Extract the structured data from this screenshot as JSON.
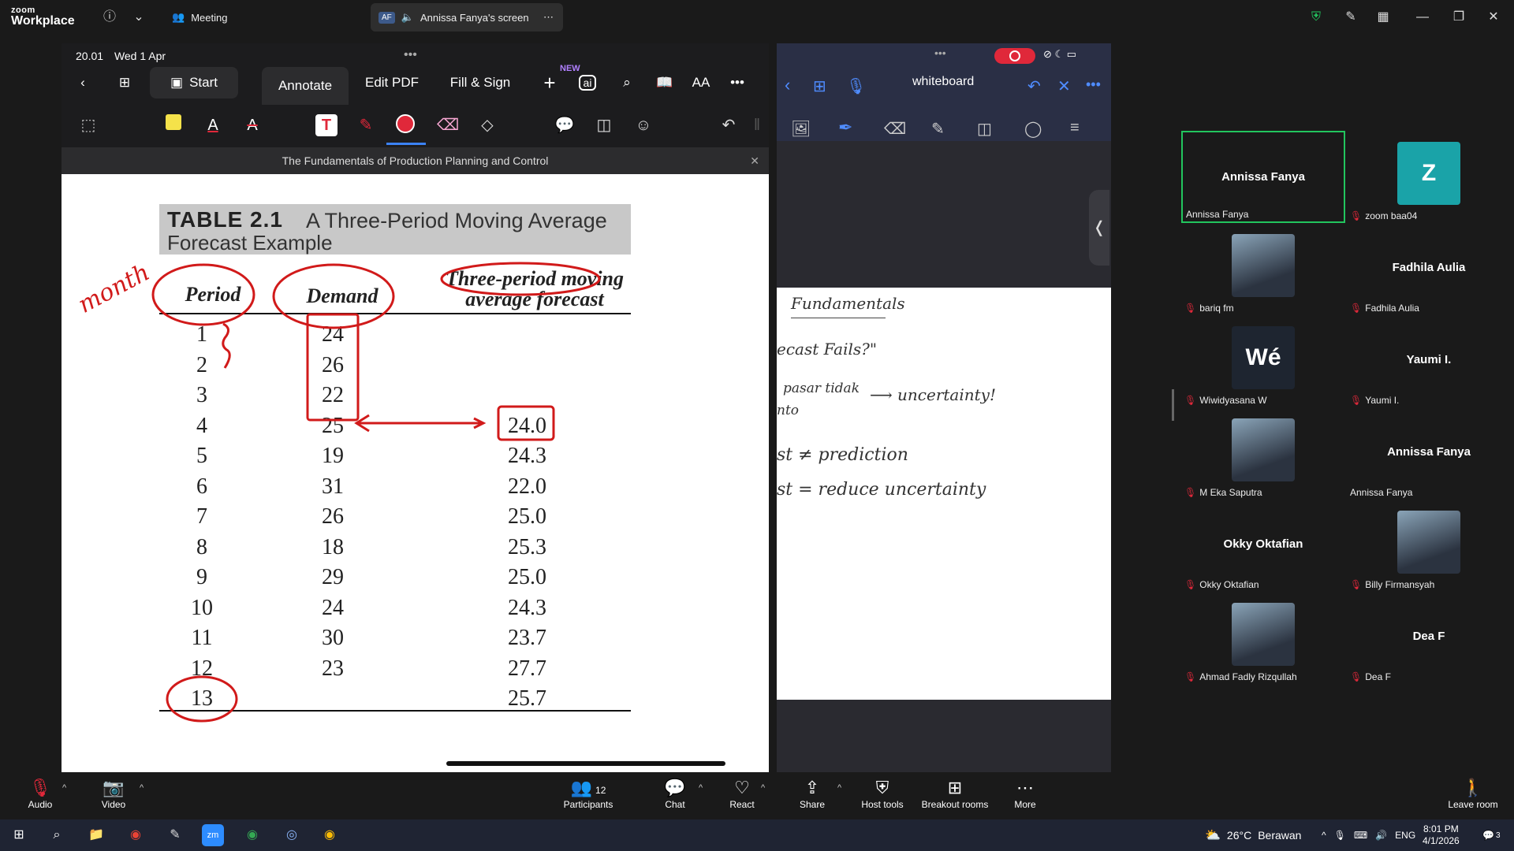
{
  "zoom": {
    "logo_small": "zoom",
    "logo_big": "Workplace",
    "tab_meeting": "Meeting",
    "tab_share_badge": "AF",
    "tab_share": "Annissa Fanya's screen"
  },
  "ipad": {
    "time": "20.01",
    "date": "Wed 1 Apr",
    "start_label": "Start",
    "tabs": [
      "Annotate",
      "Edit PDF",
      "Fill & Sign"
    ],
    "new_badge": "NEW",
    "ai_label": "ai",
    "font_size_label": "AA",
    "doc_title": "The Fundamentals of Production Planning and Control",
    "table": {
      "title_bold": "TABLE 2.1",
      "title_rest": "A Three-Period Moving Average",
      "title_line2": "Forecast Example",
      "col_period": "Period",
      "col_demand": "Demand",
      "col_forecast_1": "Three-period moving",
      "col_forecast_2": "average forecast",
      "rows": [
        {
          "period": "1",
          "demand": "24",
          "forecast": ""
        },
        {
          "period": "2",
          "demand": "26",
          "forecast": ""
        },
        {
          "period": "3",
          "demand": "22",
          "forecast": ""
        },
        {
          "period": "4",
          "demand": "25",
          "forecast": "24.0"
        },
        {
          "period": "5",
          "demand": "19",
          "forecast": "24.3"
        },
        {
          "period": "6",
          "demand": "31",
          "forecast": "22.0"
        },
        {
          "period": "7",
          "demand": "26",
          "forecast": "25.0"
        },
        {
          "period": "8",
          "demand": "18",
          "forecast": "25.3"
        },
        {
          "period": "9",
          "demand": "29",
          "forecast": "25.0"
        },
        {
          "period": "10",
          "demand": "24",
          "forecast": "24.3"
        },
        {
          "period": "11",
          "demand": "30",
          "forecast": "23.7"
        },
        {
          "period": "12",
          "demand": "23",
          "forecast": "27.7"
        },
        {
          "period": "13",
          "demand": "",
          "forecast": "25.7"
        }
      ],
      "handwritten_month": "month"
    }
  },
  "whiteboard": {
    "title": "whiteboard",
    "lines": [
      "Fundamentals",
      "ecast Fails?\"",
      "pasar tidak",
      "⟶ uncertainty!",
      "nto",
      "st ≠ prediction",
      "st = reduce uncertainty"
    ]
  },
  "participants": [
    {
      "center": "Annissa Fanya",
      "label": "Annissa Fanya",
      "muted": false,
      "speaking": true,
      "avatar": ""
    },
    {
      "center": "",
      "label": "zoom baa04",
      "muted": true,
      "avatar": "Z",
      "avatar_color": "#1aa3a8"
    },
    {
      "center": "",
      "label": "bariq fm",
      "muted": true,
      "avatar": "photo"
    },
    {
      "center": "Fadhila Aulia",
      "label": "Fadhila Aulia",
      "muted": true,
      "avatar": ""
    },
    {
      "center": "",
      "label": "Wiwidyasana W",
      "muted": true,
      "avatar": "Wé",
      "avatar_color": "#1e2530"
    },
    {
      "center": "Yaumi I.",
      "label": "Yaumi I.",
      "muted": true,
      "avatar": ""
    },
    {
      "center": "",
      "label": "M Eka Saputra",
      "muted": true,
      "avatar": "photo"
    },
    {
      "center": "Annissa Fanya",
      "label": "Annissa Fanya",
      "muted": false,
      "avatar": ""
    },
    {
      "center": "Okky Oktafian",
      "label": "Okky Oktafian",
      "muted": true,
      "avatar": ""
    },
    {
      "center": "",
      "label": "Billy Firmansyah",
      "muted": true,
      "avatar": "photo"
    },
    {
      "center": "",
      "label": "Ahmad Fadly Rizqullah",
      "muted": true,
      "avatar": "photo"
    },
    {
      "center": "Dea F",
      "label": "Dea F",
      "muted": true,
      "avatar": ""
    }
  ],
  "controls": {
    "audio": "Audio",
    "video": "Video",
    "participants": "Participants",
    "participants_count": "12",
    "chat": "Chat",
    "react": "React",
    "share": "Share",
    "host_tools": "Host tools",
    "breakout": "Breakout rooms",
    "more": "More",
    "leave": "Leave room"
  },
  "taskbar": {
    "weather_temp": "26°C",
    "weather_text": "Berawan",
    "lang": "ENG",
    "time": "8:01 PM",
    "date": "4/1/2026",
    "notif_count": "3"
  },
  "colors": {
    "zoom_bg": "#1a1a1a",
    "speaker_border": "#22c55e",
    "mute_red": "#e0283a",
    "ink_red": "#d11a1a"
  }
}
